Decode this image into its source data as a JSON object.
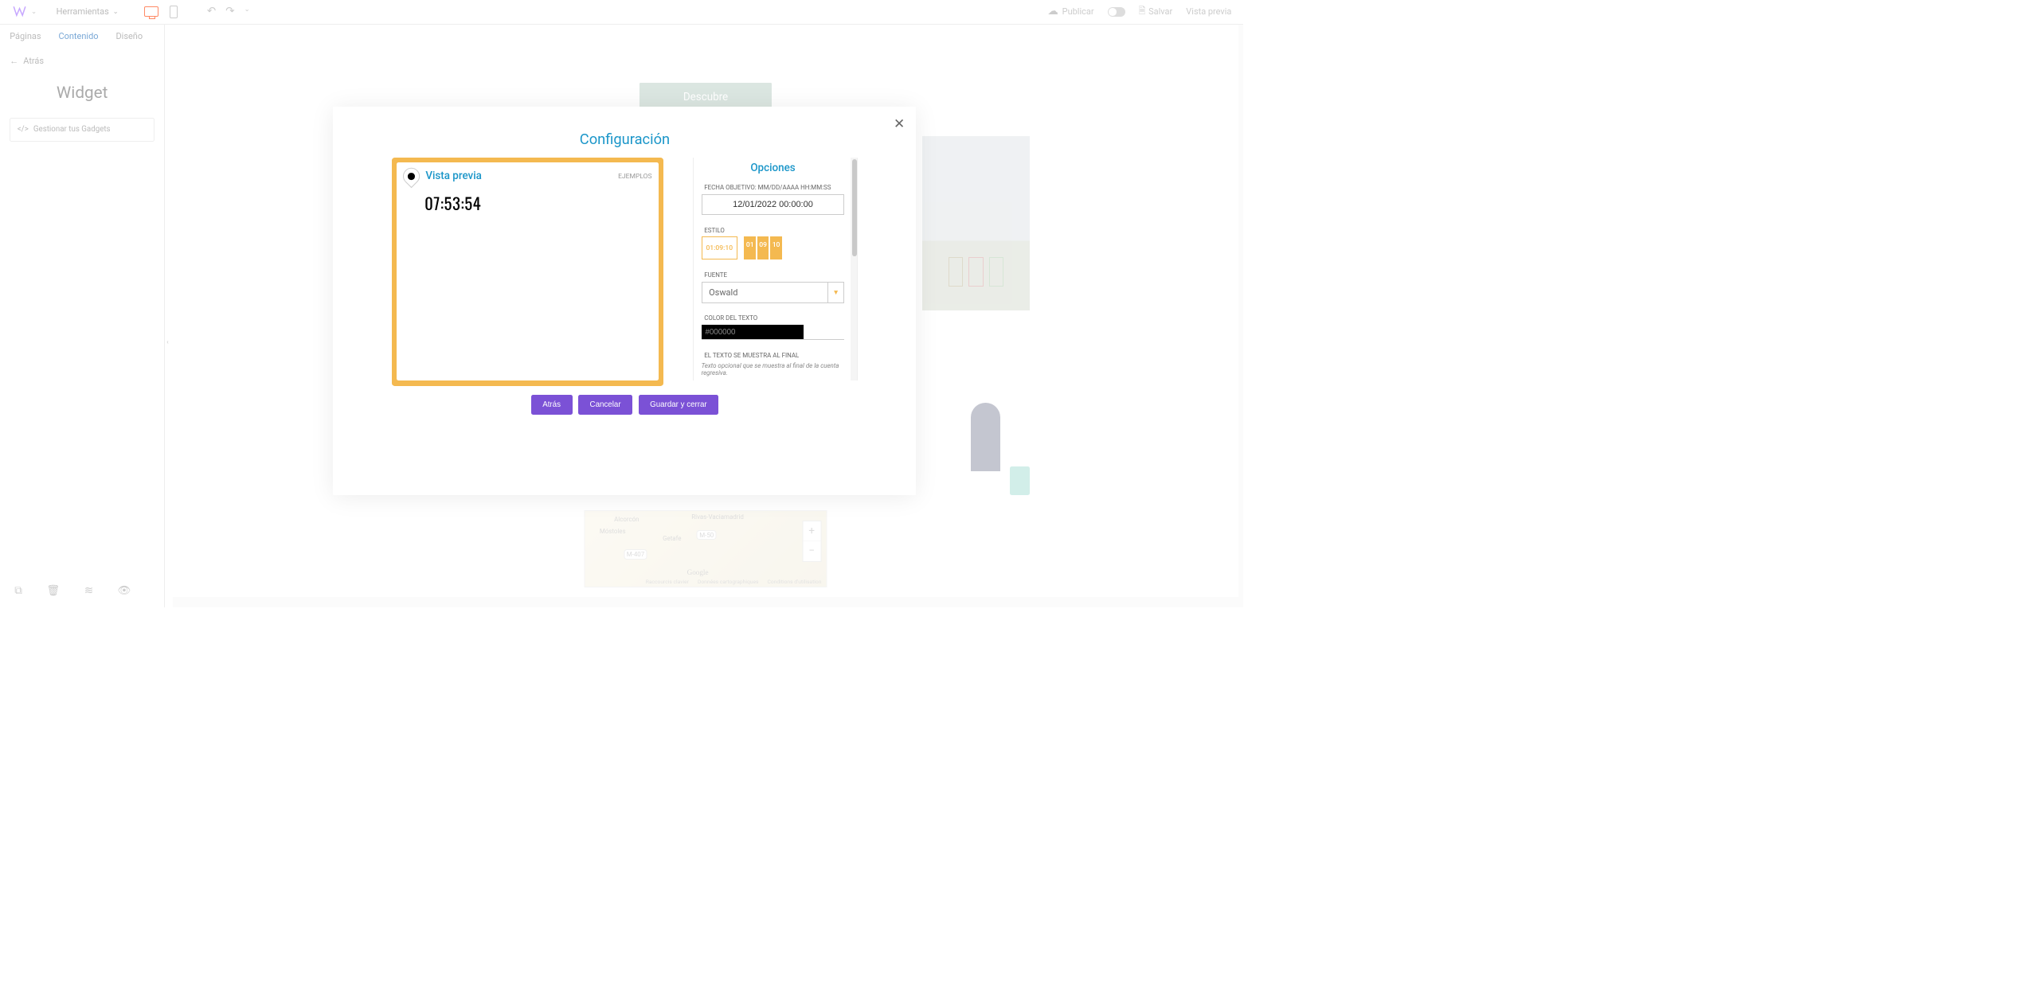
{
  "topbar": {
    "tools_label": "Herramientas",
    "publish_label": "Publicar",
    "save_label": "Salvar",
    "preview_label": "Vista previa"
  },
  "left_panel": {
    "tabs": {
      "pages": "Páginas",
      "content": "Contenido",
      "design": "Diseño"
    },
    "back_label": "Atrás",
    "widget_title": "Widget",
    "manage_gadgets": "Gestionar tus Gadgets"
  },
  "canvas": {
    "discover": "Descubre",
    "map": {
      "city1": "Alcorcón",
      "city2": "Móstoles",
      "city3": "Getafe",
      "city4": "Rivas-Vaciamadrid",
      "routes": "M-407",
      "m50": "M-50",
      "google": "Google",
      "footer1": "Raccourcis clavier",
      "footer2": "Données cartographiques",
      "footer3": "Conditions d'utilisation",
      "zoom_in": "+",
      "zoom_out": "−"
    }
  },
  "modal": {
    "title": "Configuración",
    "preview": {
      "label": "Vista previa",
      "examples": "EJEMPLOS",
      "time": "07:53:54"
    },
    "options": {
      "title": "Opciones",
      "date_label": "FECHA OBJETIVO: MM/DD/AAAA HH:MM:SS",
      "date_value": "12/01/2022 00:00:00",
      "style_label": "ESTILO",
      "style_plain": "01:09:10",
      "style_block_1": "01",
      "style_block_2": "09",
      "style_block_3": "10",
      "font_label": "FUENTE",
      "font_value": "Oswald",
      "color_label": "COLOR DEL TEXTO",
      "color_value": "#000000",
      "endtext_label": "EL TEXTO SE MUESTRA AL FINAL",
      "endtext_hint": "Texto opcional que se muestra al final de la cuenta regresiva."
    },
    "buttons": {
      "back": "Atrás",
      "cancel": "Cancelar",
      "save": "Guardar y cerrar"
    }
  }
}
